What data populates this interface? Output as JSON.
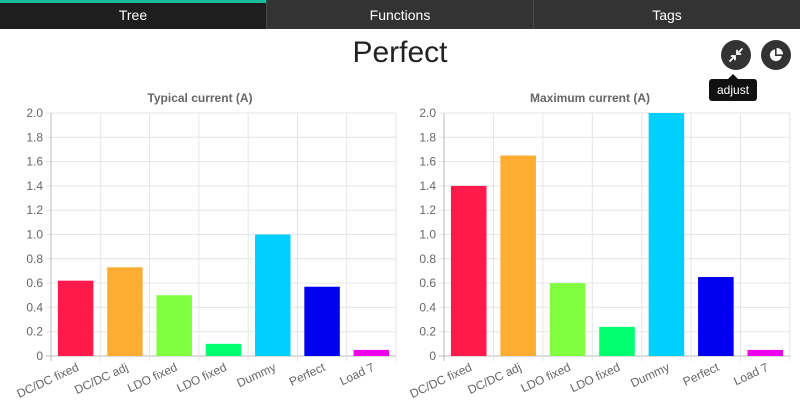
{
  "tabs": [
    {
      "label": "Tree",
      "active": true
    },
    {
      "label": "Functions",
      "active": false
    },
    {
      "label": "Tags",
      "active": false
    }
  ],
  "title": "Perfect",
  "buttons": {
    "adjust_icon": "collapse-arrows-icon",
    "pie_icon": "pie-chart-icon",
    "tooltip": "adjust"
  },
  "colors": {
    "tab_accent": "#1abc9c",
    "bars": [
      "#ff1a4b",
      "#ffac33",
      "#7fff3f",
      "#00ff6e",
      "#00d0ff",
      "#0000ee",
      "#ee00ee"
    ]
  },
  "chart_data": [
    {
      "type": "bar",
      "title": "Typical current (A)",
      "categories": [
        "DC/DC fixed",
        "DC/DC adj",
        "LDO fixed",
        "LDO fixed",
        "Dummy",
        "Perfect",
        "Load 7"
      ],
      "values": [
        0.62,
        0.73,
        0.5,
        0.1,
        1.0,
        0.57,
        0.05
      ],
      "ylim": [
        0,
        2.0
      ],
      "yticks": [
        "0",
        "0.2",
        "0.4",
        "0.6",
        "0.8",
        "1.0",
        "1.2",
        "1.4",
        "1.6",
        "1.8",
        "2.0"
      ],
      "grid": true,
      "legend": "none"
    },
    {
      "type": "bar",
      "title": "Maximum current (A)",
      "categories": [
        "DC/DC fixed",
        "DC/DC adj",
        "LDO fixed",
        "LDO fixed",
        "Dummy",
        "Perfect",
        "Load 7"
      ],
      "values": [
        1.4,
        1.65,
        0.6,
        0.24,
        2.0,
        0.65,
        0.05
      ],
      "ylim": [
        0,
        2.0
      ],
      "yticks": [
        "0",
        "0.2",
        "0.4",
        "0.6",
        "0.8",
        "1.0",
        "1.2",
        "1.4",
        "1.6",
        "1.8",
        "2.0"
      ],
      "grid": true,
      "legend": "none"
    }
  ]
}
